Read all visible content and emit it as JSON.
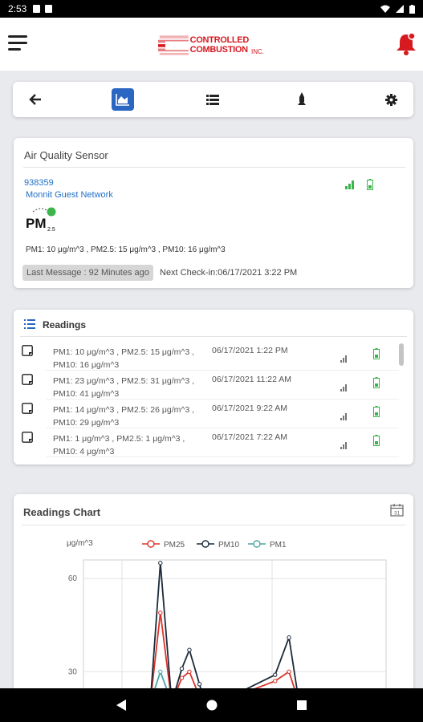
{
  "status": {
    "time": "2:53"
  },
  "logo": {
    "line1": "CONTROLLED",
    "line2": "COMBUSTION",
    "suffix": "INC."
  },
  "sensor": {
    "title": "Air Quality Sensor",
    "id": "938359",
    "network": "Monnit Guest Network",
    "reading": "PM1: 10 μg/m^3 , PM2.5: 15 μg/m^3 , PM10: 16 μg/m^3",
    "last_message": "Last Message : 92 Minutes ago",
    "next_checkin": "Next Check-in:06/17/2021  3:22 PM"
  },
  "readings": {
    "title": "Readings",
    "rows": [
      {
        "line1": "PM1: 10 μg/m^3 , PM2.5: 15 μg/m^3 ,",
        "line2": "PM10: 16 μg/m^3",
        "date": "06/17/2021 1:22 PM"
      },
      {
        "line1": "PM1: 23 μg/m^3 , PM2.5: 31 μg/m^3 ,",
        "line2": "PM10: 41 μg/m^3",
        "date": "06/17/2021 11:22 AM"
      },
      {
        "line1": "PM1: 14 μg/m^3 , PM2.5: 26 μg/m^3 ,",
        "line2": "PM10: 29 μg/m^3",
        "date": "06/17/2021 9:22 AM"
      },
      {
        "line1": "PM1: 1 μg/m^3 , PM2.5: 1 μg/m^3 ,",
        "line2": "PM10: 4 μg/m^3",
        "date": "06/17/2021 7:22 AM"
      }
    ]
  },
  "chart": {
    "title": "Readings Chart",
    "colors": {
      "PM25": "#d9342b",
      "PM10": "#1c2a3a",
      "PM1": "#4aa6a6"
    }
  },
  "chart_data": {
    "type": "line",
    "ylabel": "μg/m^3",
    "ylim": [
      20,
      66
    ],
    "yticks": [
      30,
      60
    ],
    "xlim": [
      0,
      24
    ],
    "series": [
      {
        "name": "PM25",
        "x": [
          5.3,
          6.1,
          7.0,
          7.8,
          8.4,
          9.2,
          9.6,
          10.0,
          10.7,
          15.2,
          16.3,
          17.1
        ],
        "values": [
          20,
          49,
          20,
          28,
          30,
          22,
          20,
          20,
          20,
          27,
          30,
          20
        ]
      },
      {
        "name": "PM10",
        "x": [
          5.3,
          6.1,
          7.0,
          7.8,
          8.4,
          9.2,
          9.6,
          10.0,
          10.7,
          15.2,
          16.3,
          17.1
        ],
        "values": [
          20,
          65,
          20,
          31,
          37,
          26,
          20,
          20,
          20,
          29,
          41,
          20
        ]
      },
      {
        "name": "PM1",
        "x": [
          5.3,
          6.1,
          7.0,
          7.8,
          8.4,
          9.2,
          9.6,
          10.0,
          10.7,
          15.2,
          16.3,
          17.1
        ],
        "values": [
          20,
          30,
          20,
          20,
          22,
          20,
          20,
          20,
          20,
          20,
          23,
          20
        ]
      }
    ]
  }
}
